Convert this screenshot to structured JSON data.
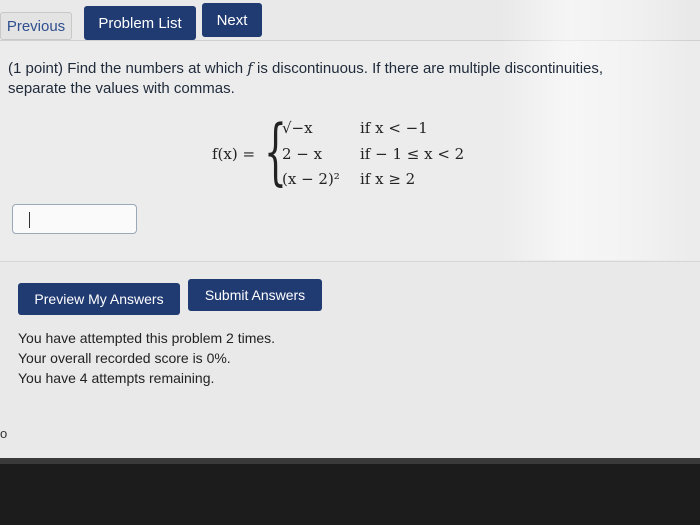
{
  "nav": {
    "previous": "Previous",
    "problem_list": "Problem List",
    "next": "Next"
  },
  "problem": {
    "text_before": "(1 point) Find the numbers at which",
    "var": "f",
    "text_after": "is discontinuous. If there are multiple discontinuities, separate the values with commas."
  },
  "formula": {
    "lhs": "f(x) =",
    "cases": [
      {
        "expr": "√−x",
        "cond": "if x < −1"
      },
      {
        "expr": "2 − x",
        "cond": "if  − 1 ≤ x < 2"
      },
      {
        "expr": "(x − 2)²",
        "cond": "if x ≥ 2"
      }
    ]
  },
  "answer": {
    "value": ""
  },
  "actions": {
    "preview": "Preview My Answers",
    "submit": "Submit Answers"
  },
  "attempts": {
    "line1": "You have attempted this problem 2 times.",
    "line2": "Your overall recorded score is 0%.",
    "line3": "You have 4 attempts remaining."
  },
  "footer_char": "o"
}
